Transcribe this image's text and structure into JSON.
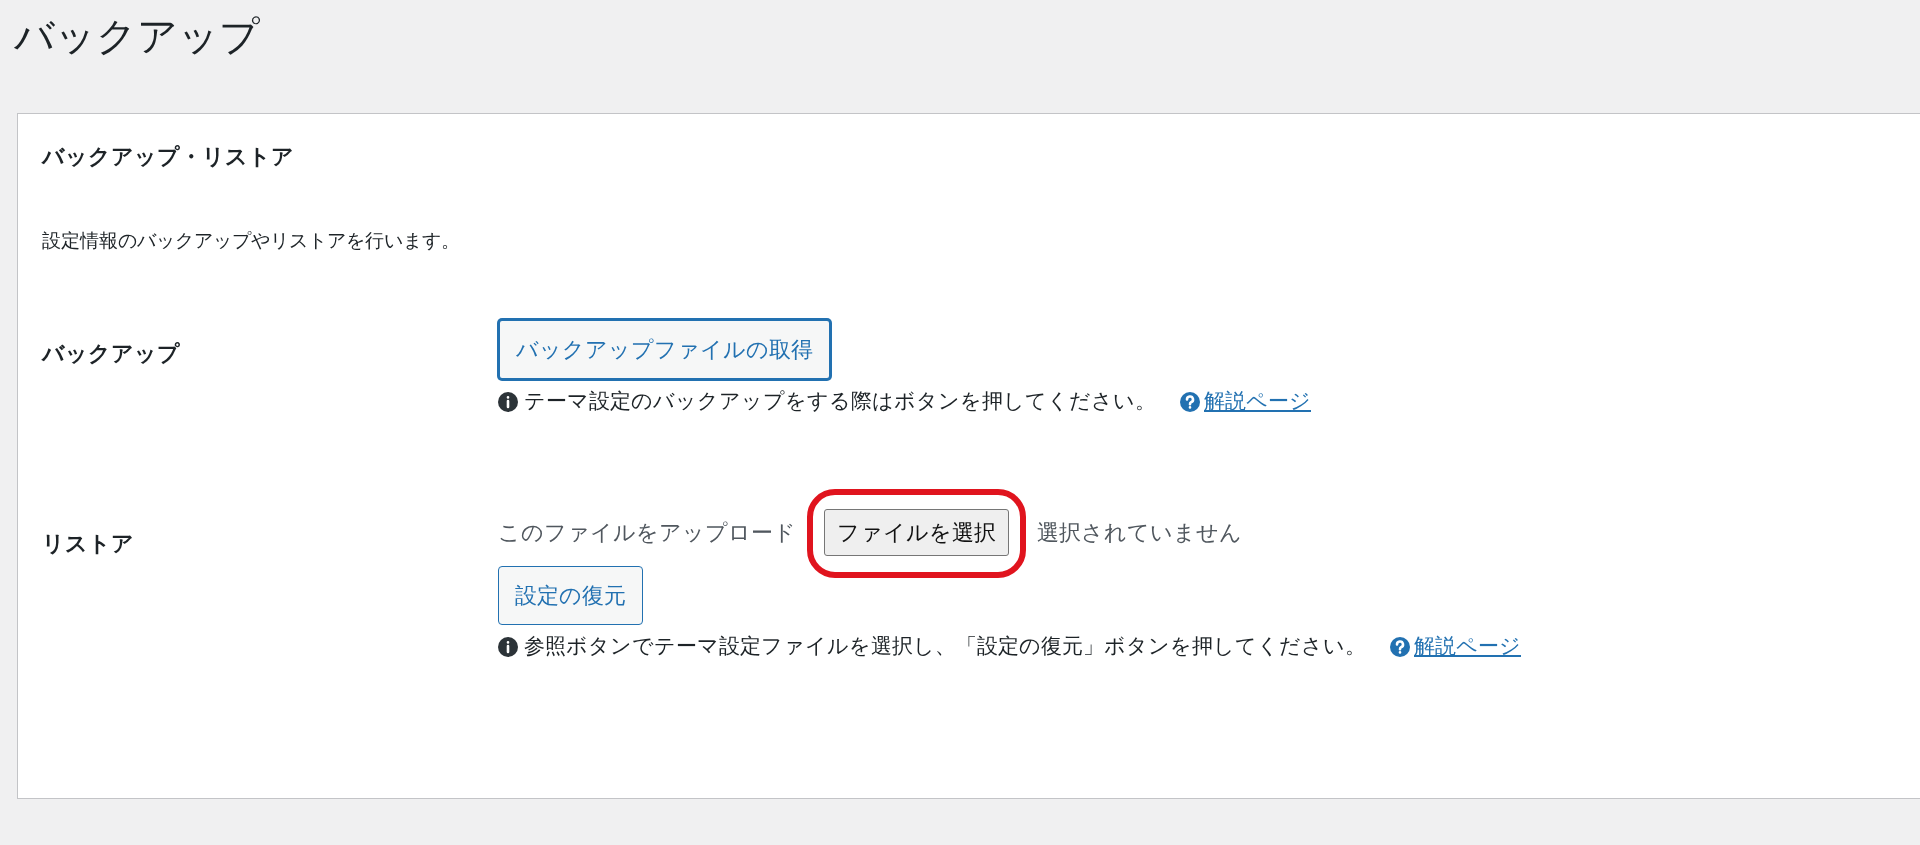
{
  "page_title": "バックアップ",
  "panel": {
    "title": "バックアップ・リストア",
    "description": "設定情報のバックアップやリストアを行います。",
    "sections": [
      {
        "kind": "download",
        "label": "バックアップ",
        "button": "バックアップファイルの取得",
        "note": "テーマ設定のバックアップをする際はボタンを押してください。",
        "help_link": "解説ページ"
      },
      {
        "kind": "restore",
        "label": "リストア",
        "upload_label": "このファイルをアップロード",
        "file_button": "ファイルを選択",
        "file_status": "選択されていません",
        "highlighted": true,
        "button": "設定の復元",
        "note": "参照ボタンでテーマ設定ファイルを選択し、「設定の復元」ボタンを押してください。",
        "help_link": "解説ページ"
      }
    ]
  }
}
